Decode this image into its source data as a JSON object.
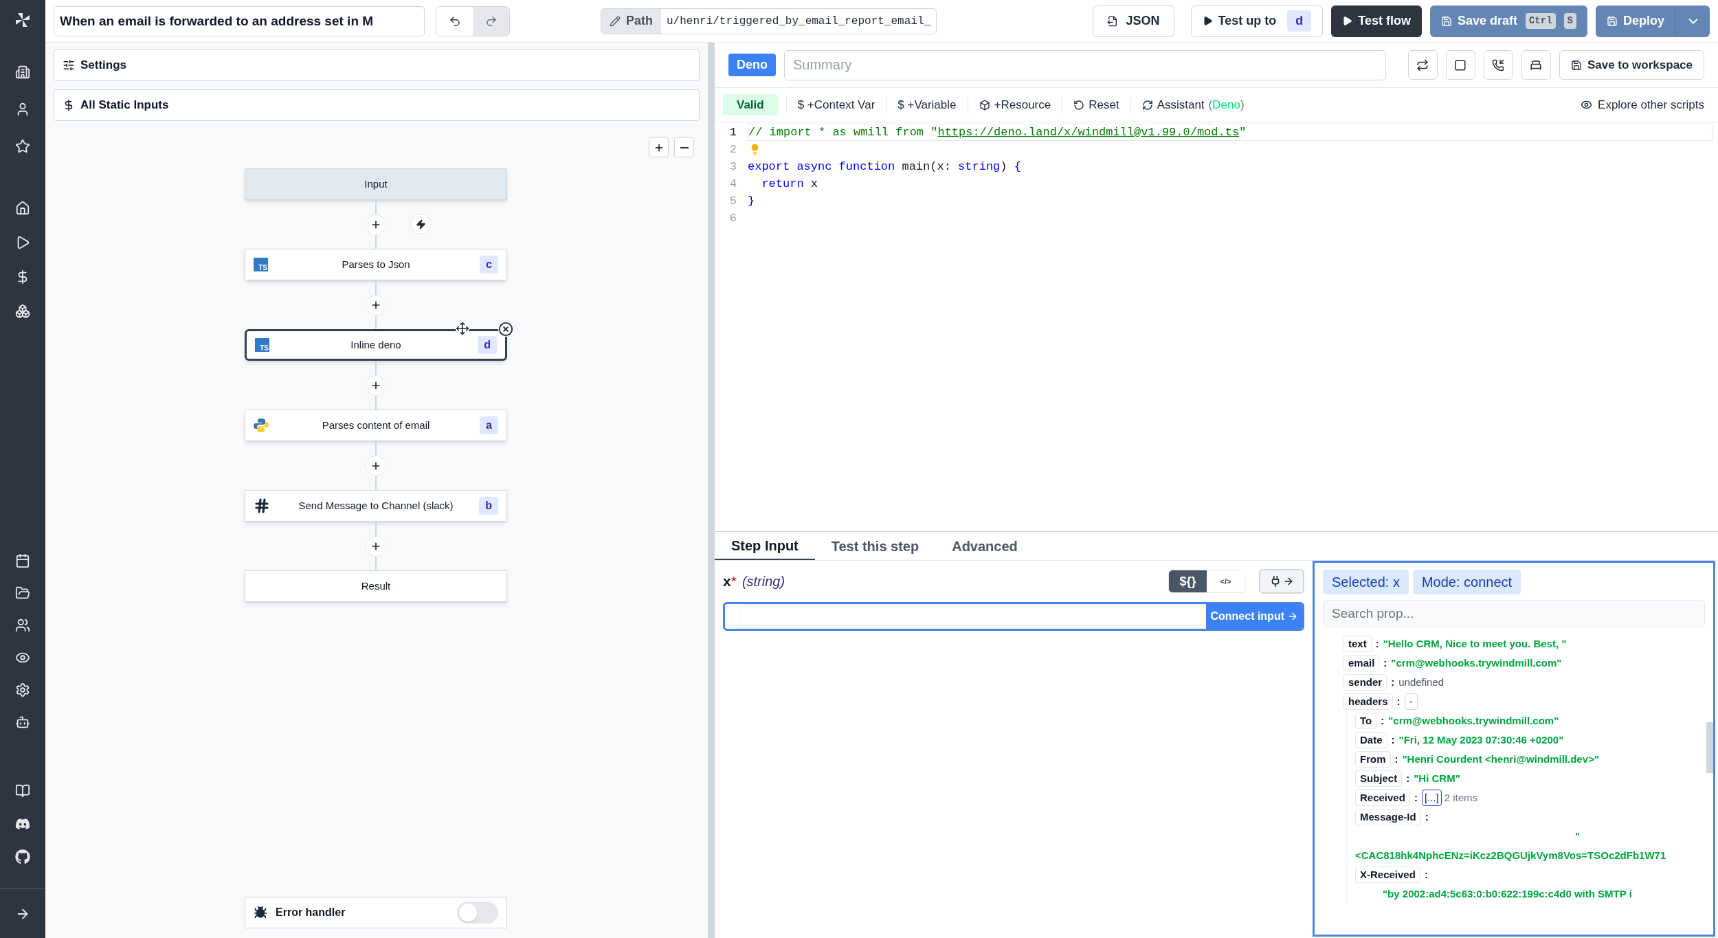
{
  "header": {
    "title_value": "When an email is forwarded to an address set in M",
    "path_label": "Path",
    "path_value": "u/henri/triggered_by_email_report_email_",
    "json_button": "JSON",
    "test_up_to": {
      "label": "Test up to",
      "badge": "d"
    },
    "test_flow": "Test flow",
    "save_draft": {
      "label": "Save draft",
      "keys": [
        "Ctrl",
        "S"
      ]
    },
    "deploy": "Deploy"
  },
  "left": {
    "settings": "Settings",
    "static_inputs": "All Static Inputs",
    "nodes": [
      {
        "kind": "input",
        "label": "Input",
        "selected": false
      },
      {
        "kind": "ts",
        "icon_text": "TS",
        "label": "Parses to Json",
        "badge": "c",
        "selected": false
      },
      {
        "kind": "ts",
        "icon_text": "TS",
        "label": "Inline deno",
        "badge": "d",
        "selected": true
      },
      {
        "kind": "python",
        "label": "Parses content of email",
        "badge": "a",
        "selected": false
      },
      {
        "kind": "slack",
        "label": "Send Message to Channel (slack)",
        "badge": "b",
        "selected": false
      },
      {
        "kind": "result",
        "label": "Result",
        "selected": false
      }
    ],
    "error_handler": {
      "label": "Error handler",
      "on": false
    }
  },
  "editor": {
    "language": "Deno",
    "summary_placeholder": "Summary",
    "save_to_workspace": "Save to workspace",
    "valid": "Valid",
    "toolbar": [
      {
        "kind": "plain",
        "label": "$ +Context Var"
      },
      {
        "kind": "plain",
        "label": "$ +Variable"
      },
      {
        "kind": "resource",
        "label": "+Resource"
      },
      {
        "kind": "reset",
        "label": "Reset"
      },
      {
        "kind": "assistant",
        "label": "Assistant",
        "open": "(",
        "accent": "Deno",
        "close": ")"
      }
    ],
    "explore": "Explore other scripts",
    "lines": [
      {
        "number": "1",
        "current": true,
        "hint": false,
        "tokens": [
          {
            "kind": "comment",
            "text": "// import * as wmill from \""
          },
          {
            "kind": "link",
            "text": "https://deno.land/x/windmill@v1.99.0/mod.ts"
          },
          {
            "kind": "comment",
            "text": "\""
          }
        ]
      },
      {
        "number": "2",
        "current": false,
        "hint": true
      },
      {
        "number": "3",
        "current": false,
        "hint": false,
        "tokens": [
          {
            "kind": "keyword",
            "text": "export async function"
          },
          {
            "kind": "plain",
            "text": " main(x: "
          },
          {
            "kind": "keyword",
            "text": "string"
          },
          {
            "kind": "plain",
            "text": ") "
          },
          {
            "kind": "keyword",
            "text": "{"
          }
        ]
      },
      {
        "number": "4",
        "current": false,
        "hint": false,
        "tokens": [
          {
            "kind": "keyword",
            "text": "  return"
          },
          {
            "kind": "plain",
            "text": " x"
          }
        ]
      },
      {
        "number": "5",
        "current": false,
        "hint": false,
        "tokens": [
          {
            "kind": "keyword",
            "text": "}"
          }
        ]
      },
      {
        "number": "6",
        "current": false,
        "hint": false
      }
    ]
  },
  "tabs": [
    {
      "label": "Step Input",
      "selected": true
    },
    {
      "label": "Test this step",
      "selected": false
    },
    {
      "label": "Advanced",
      "selected": false
    }
  ],
  "step_input": {
    "name": "x",
    "required": "*",
    "type": "(string)",
    "mode_buttons": [
      {
        "label": "${}",
        "selected": true
      },
      {
        "label": "</>",
        "selected": false
      }
    ],
    "connect": "Connect input"
  },
  "props": {
    "chips": [
      "Selected: x",
      "Mode: connect"
    ],
    "search_placeholder": "Search prop...",
    "entries": [
      {
        "key": "text",
        "separator": ":",
        "kind": "string",
        "value": "\"Hello CRM, Nice to meet you. Best, \""
      },
      {
        "key": "email",
        "separator": ":",
        "kind": "string",
        "value": "\"crm@webhooks.trywindmill.com\""
      },
      {
        "key": "sender",
        "separator": ":",
        "kind": "undefined",
        "value": "undefined"
      },
      {
        "key": "headers",
        "separator": ":",
        "kind": "object",
        "value": "-",
        "children": [
          {
            "key": "To",
            "separator": ":",
            "kind": "string",
            "value": "\"crm@webhooks.trywindmill.com\""
          },
          {
            "key": "Date",
            "separator": ":",
            "kind": "string",
            "value": "\"Fri, 12 May 2023 07:30:46 +0200\""
          },
          {
            "key": "From",
            "separator": ":",
            "kind": "string",
            "value": "\"Henri Courdent <henri@windmill.dev>\""
          },
          {
            "key": "Subject",
            "separator": ":",
            "kind": "string",
            "value": "\"Hi CRM\""
          },
          {
            "key": "Received",
            "separator": ":",
            "kind": "array",
            "value": "[...]",
            "count": "2 items"
          },
          {
            "key": "Message-Id",
            "separator": ":",
            "kind": "block",
            "lines": [
              "\"",
              "<CAC818hk4NphcENz=iKcz2BQGUjkVym8Vos=TSOc2dFb1W71"
            ]
          },
          {
            "key": "X-Received",
            "separator": ":",
            "kind": "block",
            "lines": [
              "\"by 2002:ad4:5c63:0:b0:622:199c:c4d0 with SMTP i"
            ]
          }
        ]
      }
    ]
  }
}
